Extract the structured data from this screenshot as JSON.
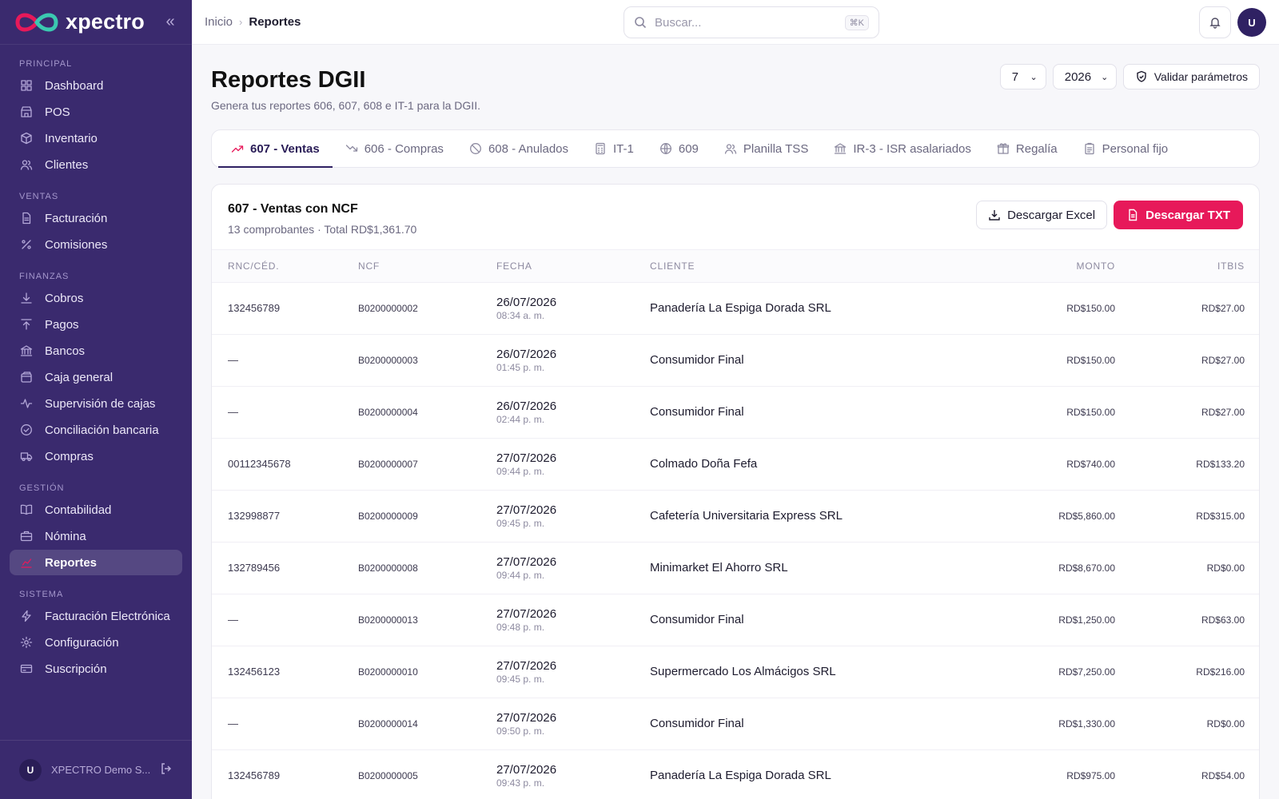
{
  "brand": {
    "name": "xpectro",
    "accent": "#e7195a",
    "secondary": "#3bc9b0"
  },
  "sidebar": {
    "sections": [
      {
        "title": "PRINCIPAL",
        "items": [
          {
            "label": "Dashboard",
            "icon": "grid-icon"
          },
          {
            "label": "POS",
            "icon": "store-icon"
          },
          {
            "label": "Inventario",
            "icon": "box-icon"
          },
          {
            "label": "Clientes",
            "icon": "users-icon"
          }
        ]
      },
      {
        "title": "VENTAS",
        "items": [
          {
            "label": "Facturación",
            "icon": "file-icon"
          },
          {
            "label": "Comisiones",
            "icon": "percent-icon"
          }
        ]
      },
      {
        "title": "FINANZAS",
        "items": [
          {
            "label": "Cobros",
            "icon": "download-icon"
          },
          {
            "label": "Pagos",
            "icon": "upload-icon"
          },
          {
            "label": "Bancos",
            "icon": "bank-icon"
          },
          {
            "label": "Caja general",
            "icon": "wallet-icon"
          },
          {
            "label": "Supervisión de cajas",
            "icon": "activity-icon"
          },
          {
            "label": "Conciliación bancaria",
            "icon": "check-circle-icon"
          },
          {
            "label": "Compras",
            "icon": "truck-icon"
          }
        ]
      },
      {
        "title": "GESTIÓN",
        "items": [
          {
            "label": "Contabilidad",
            "icon": "book-icon"
          },
          {
            "label": "Nómina",
            "icon": "briefcase-icon"
          },
          {
            "label": "Reportes",
            "icon": "chart-icon",
            "active": true
          }
        ]
      },
      {
        "title": "SISTEMA",
        "items": [
          {
            "label": "Facturación Electrónica",
            "icon": "bolt-icon"
          },
          {
            "label": "Configuración",
            "icon": "gear-icon"
          },
          {
            "label": "Suscripción",
            "icon": "card-icon"
          }
        ]
      }
    ],
    "footer": {
      "avatar": "U",
      "company": "XPECTRO Demo S..."
    }
  },
  "topbar": {
    "breadcrumb": {
      "home": "Inicio",
      "current": "Reportes"
    },
    "search": {
      "placeholder": "Buscar...",
      "shortcut": "⌘K"
    },
    "avatar": "U"
  },
  "page": {
    "title": "Reportes DGII",
    "subtitle": "Genera tus reportes 606, 607, 608 e IT-1 para la DGII.",
    "month": "7",
    "year": "2026",
    "validate_label": "Validar parámetros"
  },
  "tabs": [
    {
      "label": "607 - Ventas",
      "icon": "trend-up-icon",
      "active": true
    },
    {
      "label": "606 - Compras",
      "icon": "trend-down-icon"
    },
    {
      "label": "608 - Anulados",
      "icon": "ban-icon"
    },
    {
      "label": "IT-1",
      "icon": "calculator-icon"
    },
    {
      "label": "609",
      "icon": "globe-icon"
    },
    {
      "label": "Planilla TSS",
      "icon": "users-icon"
    },
    {
      "label": "IR-3 - ISR asalariados",
      "icon": "bank-icon"
    },
    {
      "label": "Regalía",
      "icon": "gift-icon"
    },
    {
      "label": "Personal fijo",
      "icon": "clipboard-icon"
    }
  ],
  "report": {
    "title": "607 - Ventas con NCF",
    "summary": "13 comprobantes · Total RD$1,361.70",
    "excel_label": "Descargar Excel",
    "txt_label": "Descargar TXT",
    "columns": {
      "rnc": "RNC/CÉD.",
      "ncf": "NCF",
      "fecha": "FECHA",
      "cliente": "CLIENTE",
      "monto": "MONTO",
      "itbis": "ITBIS"
    },
    "rows": [
      {
        "rnc": "132456789",
        "ncf": "B0200000002",
        "date": "26/07/2026",
        "time": "08:34 a. m.",
        "client": "Panadería La Espiga Dorada SRL",
        "monto": "RD$150.00",
        "itbis": "RD$27.00"
      },
      {
        "rnc": "—",
        "ncf": "B0200000003",
        "date": "26/07/2026",
        "time": "01:45 p. m.",
        "client": "Consumidor Final",
        "monto": "RD$150.00",
        "itbis": "RD$27.00"
      },
      {
        "rnc": "—",
        "ncf": "B0200000004",
        "date": "26/07/2026",
        "time": "02:44 p. m.",
        "client": "Consumidor Final",
        "monto": "RD$150.00",
        "itbis": "RD$27.00"
      },
      {
        "rnc": "00112345678",
        "ncf": "B0200000007",
        "date": "27/07/2026",
        "time": "09:44 p. m.",
        "client": "Colmado Doña Fefa",
        "monto": "RD$740.00",
        "itbis": "RD$133.20"
      },
      {
        "rnc": "132998877",
        "ncf": "B0200000009",
        "date": "27/07/2026",
        "time": "09:45 p. m.",
        "client": "Cafetería Universitaria Express SRL",
        "monto": "RD$5,860.00",
        "itbis": "RD$315.00"
      },
      {
        "rnc": "132789456",
        "ncf": "B0200000008",
        "date": "27/07/2026",
        "time": "09:44 p. m.",
        "client": "Minimarket El Ahorro SRL",
        "monto": "RD$8,670.00",
        "itbis": "RD$0.00"
      },
      {
        "rnc": "—",
        "ncf": "B0200000013",
        "date": "27/07/2026",
        "time": "09:48 p. m.",
        "client": "Consumidor Final",
        "monto": "RD$1,250.00",
        "itbis": "RD$63.00"
      },
      {
        "rnc": "132456123",
        "ncf": "B0200000010",
        "date": "27/07/2026",
        "time": "09:45 p. m.",
        "client": "Supermercado Los Almácigos SRL",
        "monto": "RD$7,250.00",
        "itbis": "RD$216.00"
      },
      {
        "rnc": "—",
        "ncf": "B0200000014",
        "date": "27/07/2026",
        "time": "09:50 p. m.",
        "client": "Consumidor Final",
        "monto": "RD$1,330.00",
        "itbis": "RD$0.00"
      },
      {
        "rnc": "132456789",
        "ncf": "B0200000005",
        "date": "27/07/2026",
        "time": "09:43 p. m.",
        "client": "Panadería La Espiga Dorada SRL",
        "monto": "RD$975.00",
        "itbis": "RD$54.00"
      }
    ]
  }
}
